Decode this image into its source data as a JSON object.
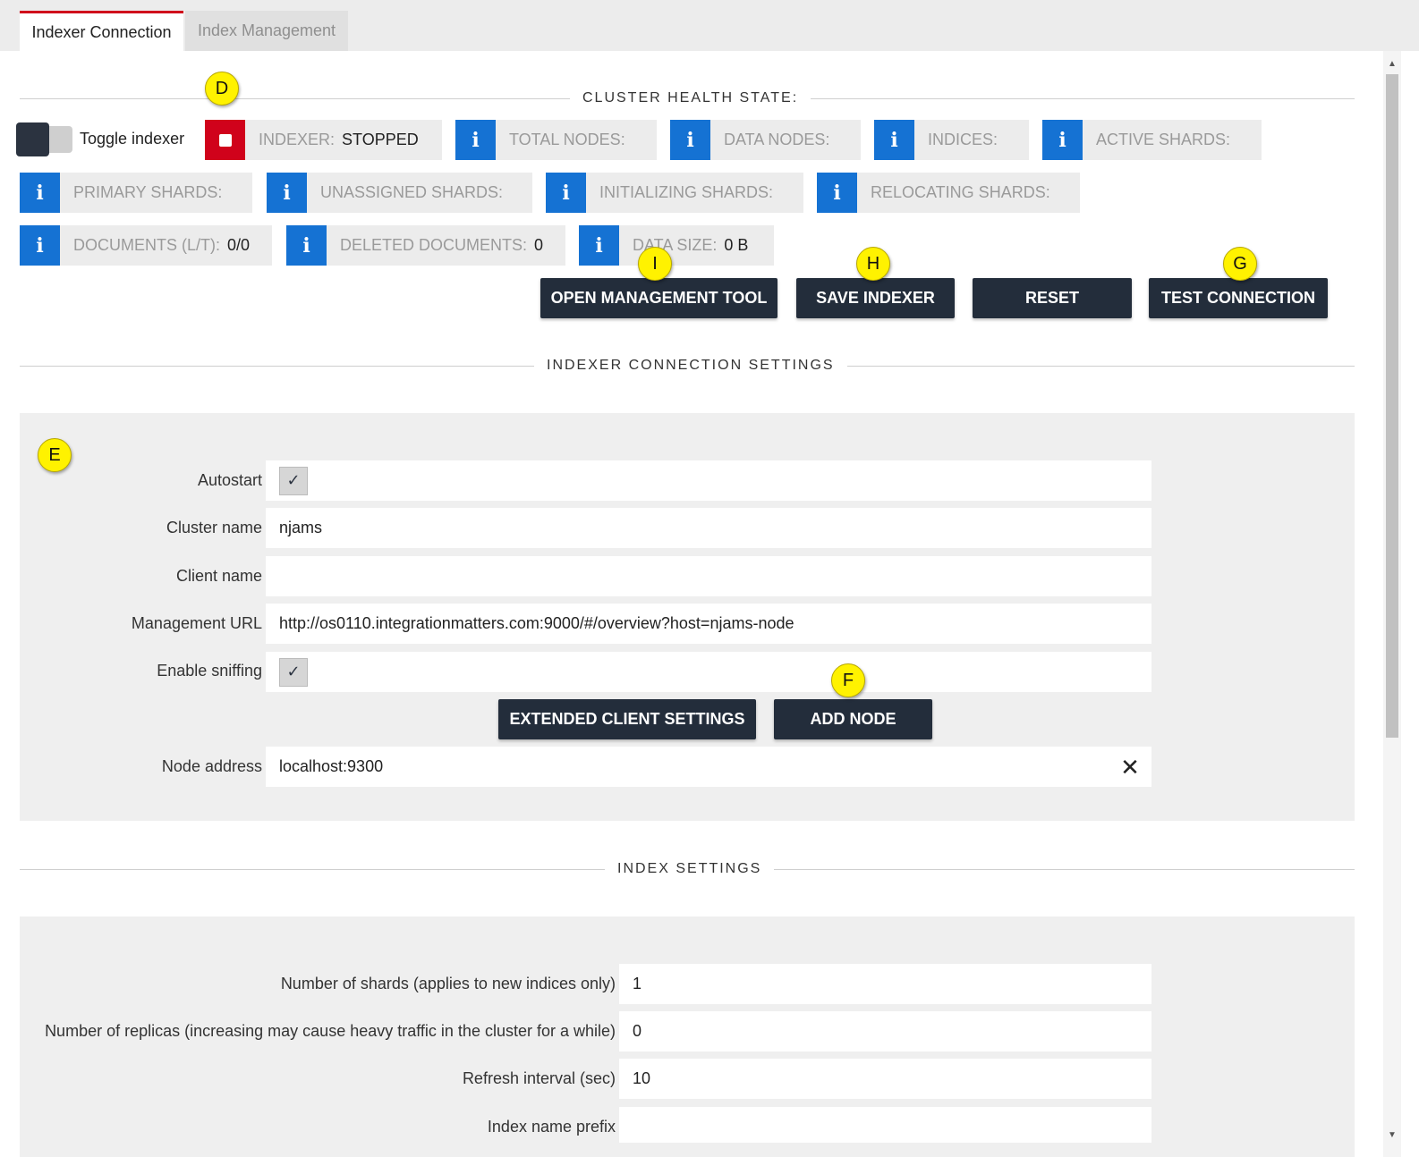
{
  "tabs": [
    {
      "label": "Indexer Connection",
      "active": true
    },
    {
      "label": "Index Management",
      "active": false
    }
  ],
  "cluster_health": {
    "section_title": "CLUSTER HEALTH STATE:",
    "toggle_label": "Toggle indexer",
    "indexer_state_label": "INDEXER:",
    "indexer_state_value": "STOPPED",
    "total_nodes_label": "TOTAL NODES:",
    "data_nodes_label": "DATA NODES:",
    "indices_label": "INDICES:",
    "active_shards_label": "ACTIVE SHARDS:",
    "primary_shards_label": "PRIMARY SHARDS:",
    "unassigned_shards_label": "UNASSIGNED SHARDS:",
    "initializing_shards_label": "INITIALIZING SHARDS:",
    "relocating_shards_label": "RELOCATING SHARDS:",
    "documents_label": "DOCUMENTS (L/T):",
    "documents_value": "0/0",
    "deleted_documents_label": "DELETED DOCUMENTS:",
    "deleted_documents_value": "0",
    "data_size_label": "DATA SIZE:",
    "data_size_value": "0 B"
  },
  "actions": {
    "open_management_tool": "OPEN MANAGEMENT TOOL",
    "save_indexer": "SAVE INDEXER",
    "reset": "RESET",
    "test_connection": "TEST CONNECTION"
  },
  "connection_settings": {
    "section_title": "INDEXER CONNECTION SETTINGS",
    "autostart_label": "Autostart",
    "autostart_checked": true,
    "cluster_name_label": "Cluster name",
    "cluster_name_value": "njams",
    "client_name_label": "Client name",
    "client_name_value": "",
    "management_url_label": "Management URL",
    "management_url_value": "http://os0110.integrationmatters.com:9000/#/overview?host=njams-node",
    "enable_sniffing_label": "Enable sniffing",
    "enable_sniffing_checked": true,
    "extended_client_settings": "EXTENDED CLIENT SETTINGS",
    "add_node": "ADD NODE",
    "node_address_label": "Node address",
    "node_address_value": "localhost:9300"
  },
  "index_settings": {
    "section_title": "INDEX SETTINGS",
    "shards_label": "Number of shards (applies to new indices only)",
    "shards_value": "1",
    "replicas_label": "Number of replicas (increasing may cause heavy traffic in the cluster for a while)",
    "replicas_value": "0",
    "refresh_label": "Refresh interval (sec)",
    "refresh_value": "10",
    "prefix_label": "Index name prefix",
    "prefix_value": ""
  },
  "markers": {
    "d": "D",
    "e": "E",
    "f": "F",
    "g": "G",
    "h": "H",
    "i": "I"
  },
  "icons": {
    "info": "i",
    "stop": "stop-icon",
    "check": "✓",
    "close": "✕"
  },
  "colors": {
    "accent_red": "#d0021b",
    "info_blue": "#1572d3",
    "button_dark": "#232d3b",
    "marker_yellow": "#fff200"
  }
}
